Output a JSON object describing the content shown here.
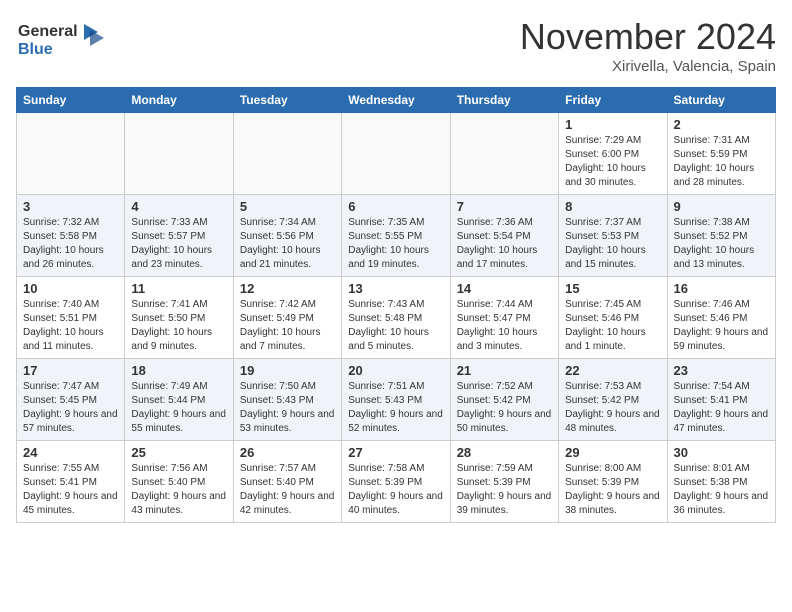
{
  "logo": {
    "line1": "General",
    "line2": "Blue"
  },
  "title": "November 2024",
  "subtitle": "Xirivella, Valencia, Spain",
  "days_of_week": [
    "Sunday",
    "Monday",
    "Tuesday",
    "Wednesday",
    "Thursday",
    "Friday",
    "Saturday"
  ],
  "weeks": [
    [
      {
        "day": "",
        "info": ""
      },
      {
        "day": "",
        "info": ""
      },
      {
        "day": "",
        "info": ""
      },
      {
        "day": "",
        "info": ""
      },
      {
        "day": "",
        "info": ""
      },
      {
        "day": "1",
        "info": "Sunrise: 7:29 AM\nSunset: 6:00 PM\nDaylight: 10 hours and 30 minutes."
      },
      {
        "day": "2",
        "info": "Sunrise: 7:31 AM\nSunset: 5:59 PM\nDaylight: 10 hours and 28 minutes."
      }
    ],
    [
      {
        "day": "3",
        "info": "Sunrise: 7:32 AM\nSunset: 5:58 PM\nDaylight: 10 hours and 26 minutes."
      },
      {
        "day": "4",
        "info": "Sunrise: 7:33 AM\nSunset: 5:57 PM\nDaylight: 10 hours and 23 minutes."
      },
      {
        "day": "5",
        "info": "Sunrise: 7:34 AM\nSunset: 5:56 PM\nDaylight: 10 hours and 21 minutes."
      },
      {
        "day": "6",
        "info": "Sunrise: 7:35 AM\nSunset: 5:55 PM\nDaylight: 10 hours and 19 minutes."
      },
      {
        "day": "7",
        "info": "Sunrise: 7:36 AM\nSunset: 5:54 PM\nDaylight: 10 hours and 17 minutes."
      },
      {
        "day": "8",
        "info": "Sunrise: 7:37 AM\nSunset: 5:53 PM\nDaylight: 10 hours and 15 minutes."
      },
      {
        "day": "9",
        "info": "Sunrise: 7:38 AM\nSunset: 5:52 PM\nDaylight: 10 hours and 13 minutes."
      }
    ],
    [
      {
        "day": "10",
        "info": "Sunrise: 7:40 AM\nSunset: 5:51 PM\nDaylight: 10 hours and 11 minutes."
      },
      {
        "day": "11",
        "info": "Sunrise: 7:41 AM\nSunset: 5:50 PM\nDaylight: 10 hours and 9 minutes."
      },
      {
        "day": "12",
        "info": "Sunrise: 7:42 AM\nSunset: 5:49 PM\nDaylight: 10 hours and 7 minutes."
      },
      {
        "day": "13",
        "info": "Sunrise: 7:43 AM\nSunset: 5:48 PM\nDaylight: 10 hours and 5 minutes."
      },
      {
        "day": "14",
        "info": "Sunrise: 7:44 AM\nSunset: 5:47 PM\nDaylight: 10 hours and 3 minutes."
      },
      {
        "day": "15",
        "info": "Sunrise: 7:45 AM\nSunset: 5:46 PM\nDaylight: 10 hours and 1 minute."
      },
      {
        "day": "16",
        "info": "Sunrise: 7:46 AM\nSunset: 5:46 PM\nDaylight: 9 hours and 59 minutes."
      }
    ],
    [
      {
        "day": "17",
        "info": "Sunrise: 7:47 AM\nSunset: 5:45 PM\nDaylight: 9 hours and 57 minutes."
      },
      {
        "day": "18",
        "info": "Sunrise: 7:49 AM\nSunset: 5:44 PM\nDaylight: 9 hours and 55 minutes."
      },
      {
        "day": "19",
        "info": "Sunrise: 7:50 AM\nSunset: 5:43 PM\nDaylight: 9 hours and 53 minutes."
      },
      {
        "day": "20",
        "info": "Sunrise: 7:51 AM\nSunset: 5:43 PM\nDaylight: 9 hours and 52 minutes."
      },
      {
        "day": "21",
        "info": "Sunrise: 7:52 AM\nSunset: 5:42 PM\nDaylight: 9 hours and 50 minutes."
      },
      {
        "day": "22",
        "info": "Sunrise: 7:53 AM\nSunset: 5:42 PM\nDaylight: 9 hours and 48 minutes."
      },
      {
        "day": "23",
        "info": "Sunrise: 7:54 AM\nSunset: 5:41 PM\nDaylight: 9 hours and 47 minutes."
      }
    ],
    [
      {
        "day": "24",
        "info": "Sunrise: 7:55 AM\nSunset: 5:41 PM\nDaylight: 9 hours and 45 minutes."
      },
      {
        "day": "25",
        "info": "Sunrise: 7:56 AM\nSunset: 5:40 PM\nDaylight: 9 hours and 43 minutes."
      },
      {
        "day": "26",
        "info": "Sunrise: 7:57 AM\nSunset: 5:40 PM\nDaylight: 9 hours and 42 minutes."
      },
      {
        "day": "27",
        "info": "Sunrise: 7:58 AM\nSunset: 5:39 PM\nDaylight: 9 hours and 40 minutes."
      },
      {
        "day": "28",
        "info": "Sunrise: 7:59 AM\nSunset: 5:39 PM\nDaylight: 9 hours and 39 minutes."
      },
      {
        "day": "29",
        "info": "Sunrise: 8:00 AM\nSunset: 5:39 PM\nDaylight: 9 hours and 38 minutes."
      },
      {
        "day": "30",
        "info": "Sunrise: 8:01 AM\nSunset: 5:38 PM\nDaylight: 9 hours and 36 minutes."
      }
    ]
  ]
}
